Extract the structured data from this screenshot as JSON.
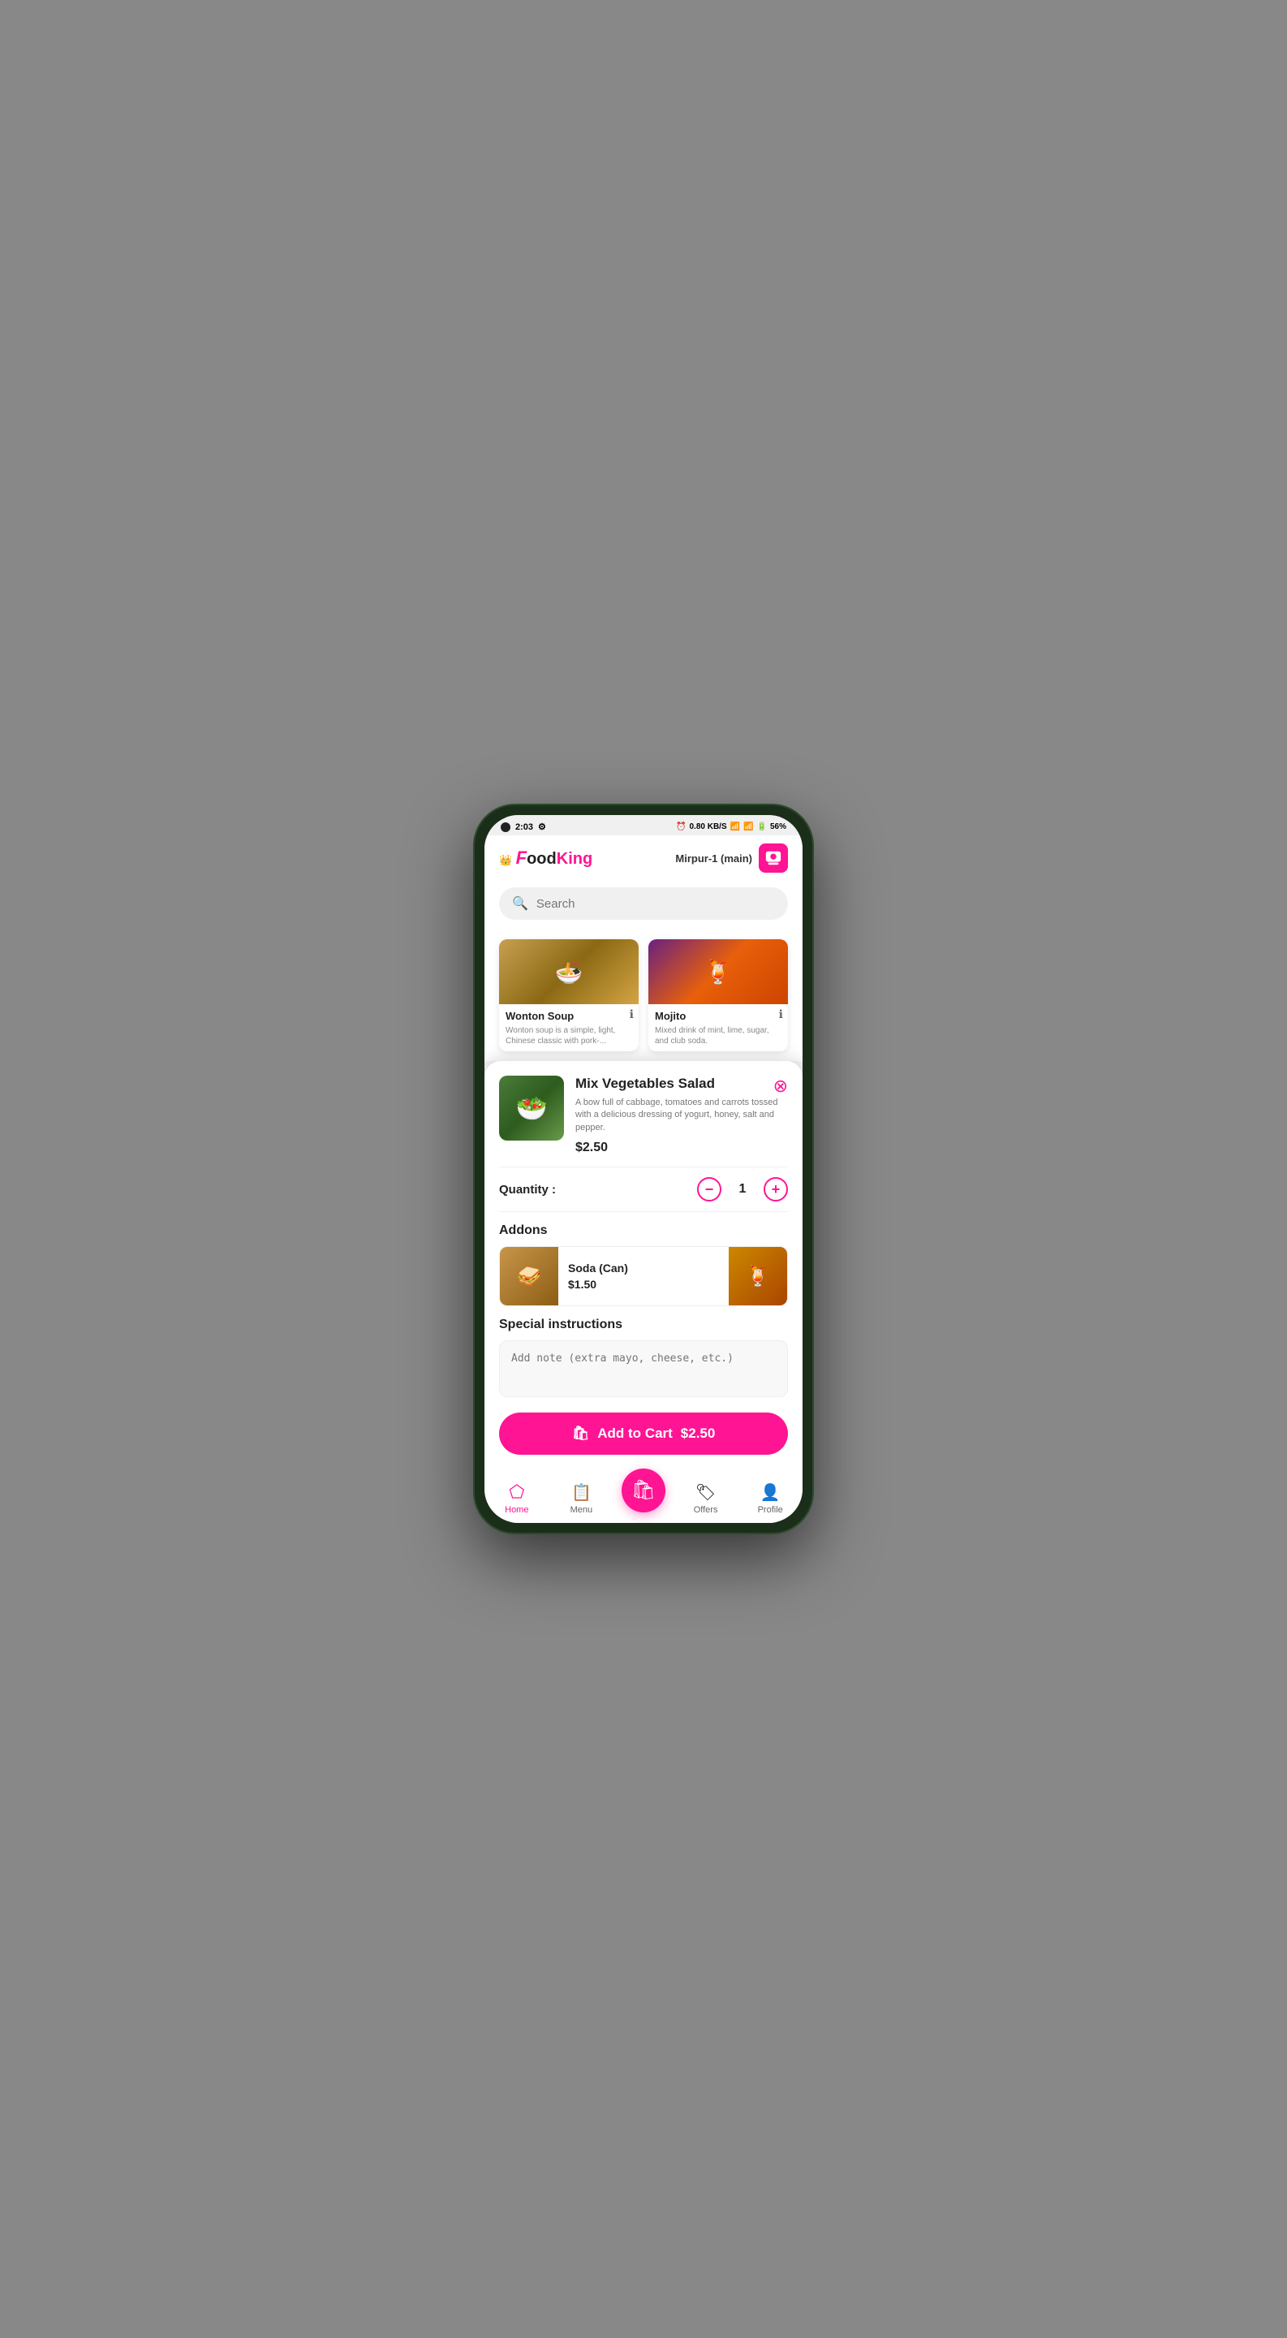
{
  "status_bar": {
    "time": "2:03",
    "battery": "56%",
    "signal": "●●●",
    "wifi": "WiFi"
  },
  "header": {
    "logo": "FoodKing",
    "location": "Mirpur-1 (main)"
  },
  "search": {
    "placeholder": "Search"
  },
  "food_cards": [
    {
      "name": "Wonton Soup",
      "description": "Wonton soup is a simple, light, Chinese classic with pork-..."
    },
    {
      "name": "Mojito",
      "description": "Mixed drink of mint, lime, sugar, and club soda."
    }
  ],
  "modal": {
    "item_name": "Mix Vegetables Salad",
    "item_description": "A bow full of cabbage, tomatoes and carrots tossed with a delicious dressing of yogurt, honey, salt and pepper.",
    "item_price": "$2.50",
    "quantity_label": "Quantity :",
    "quantity_value": "1",
    "addons_label": "Addons",
    "addon_name": "Soda (Can)",
    "addon_price": "$1.50",
    "special_instructions_label": "Special instructions",
    "note_placeholder": "Add note (extra mayo, cheese, etc.)",
    "add_to_cart_label": "Add to Cart",
    "add_to_cart_price": "$2.50"
  },
  "bottom_nav": {
    "items": [
      {
        "label": "Home",
        "active": true
      },
      {
        "label": "Menu",
        "active": false
      },
      {
        "label": "",
        "cart": true
      },
      {
        "label": "Offers",
        "active": false
      },
      {
        "label": "Profile",
        "active": false
      }
    ]
  }
}
